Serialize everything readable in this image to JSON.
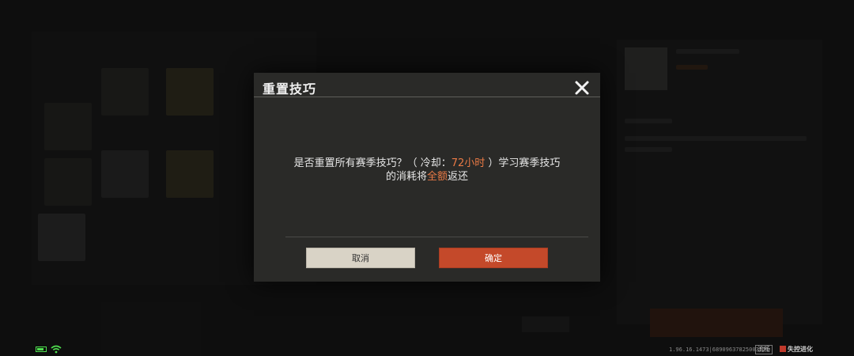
{
  "dialog": {
    "title": "重置技巧",
    "message_line1_a": "是否重置所有赛季技巧？（ 冷却：",
    "message_line1_highlight": "72小时",
    "message_line1_b": " ）学习赛季技巧",
    "message_line2_a": "的消耗将",
    "message_line2_highlight": "全额",
    "message_line2_b": "返还",
    "cancel_label": "取消",
    "confirm_label": "确定",
    "close_icon": "close-icon"
  },
  "status_bar": {
    "version": "1.96.16.1473|68909637825003521",
    "fluency": "流畅",
    "logo_text": "失控进化"
  },
  "colors": {
    "highlight": "#ea7a45",
    "confirm": "#c4492a",
    "cancel": "#d9d3c6",
    "battery": "#4fe04f"
  }
}
